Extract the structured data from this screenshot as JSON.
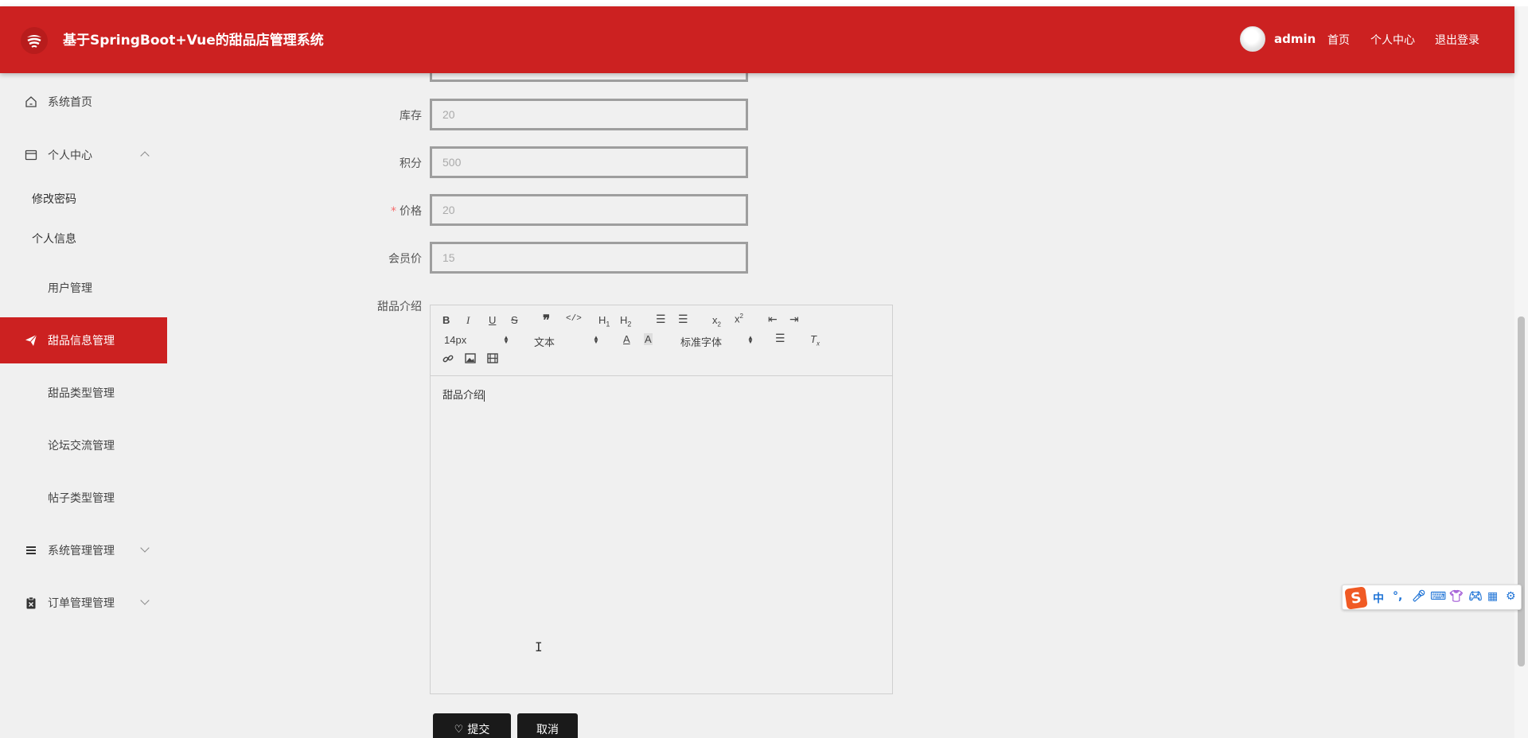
{
  "header": {
    "title": "基于SpringBoot+Vue的甜品店管理系统",
    "username": "admin",
    "nav": [
      "首页",
      "个人中心",
      "退出登录"
    ],
    "colors": {
      "brand": "#cc2121"
    }
  },
  "sidebar": {
    "items": [
      {
        "label": "系统首页",
        "icon": "home-icon"
      },
      {
        "label": "个人中心",
        "icon": "profile-card-icon",
        "expanded": true,
        "children": [
          "修改密码",
          "个人信息"
        ]
      },
      {
        "label": "用户管理",
        "icon": "grid-icon"
      },
      {
        "label": "甜品信息管理",
        "icon": "paper-plane-icon",
        "active": true
      },
      {
        "label": "甜品类型管理",
        "icon": "grid-icon"
      },
      {
        "label": "论坛交流管理",
        "icon": "grid-icon"
      },
      {
        "label": "帖子类型管理",
        "icon": "grid-icon"
      },
      {
        "label": "系统管理管理",
        "icon": "list-icon",
        "expanded": false
      },
      {
        "label": "订单管理管理",
        "icon": "clipboard-icon",
        "expanded": false
      }
    ]
  },
  "form": {
    "fields": [
      {
        "label": "库存",
        "value": "20",
        "required": false
      },
      {
        "label": "积分",
        "value": "500",
        "required": false
      },
      {
        "label": "价格",
        "value": "20",
        "required": true
      },
      {
        "label": "会员价",
        "value": "15",
        "required": false
      }
    ],
    "required_mark": "*",
    "editor": {
      "label": "甜品介绍",
      "font_size": "14px",
      "text_style": "文本",
      "font_family": "标准字体",
      "content": "甜品介绍"
    },
    "buttons": {
      "submit": "提交",
      "cancel": "取消"
    }
  },
  "ime": {
    "logo": "S",
    "mode": "中",
    "punct": "°,"
  }
}
